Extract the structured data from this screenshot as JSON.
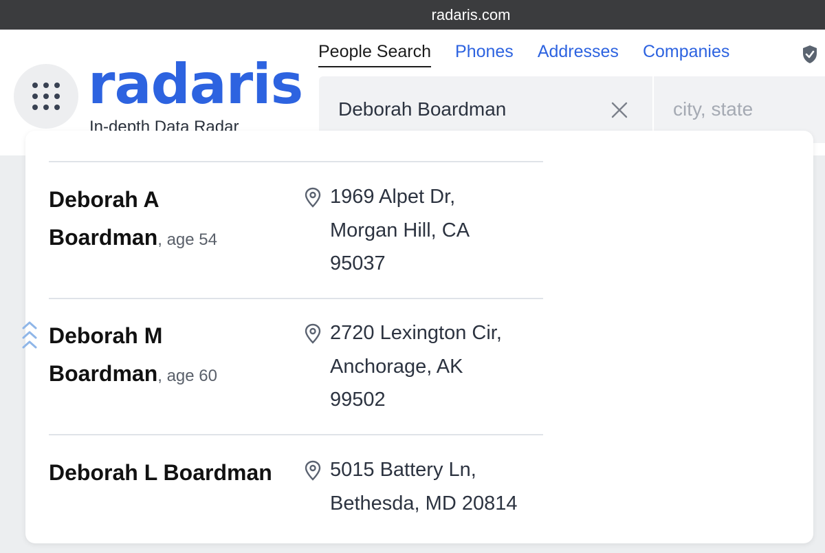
{
  "browser": {
    "url": "radaris.com"
  },
  "header": {
    "logo_text": "radaris",
    "tagline": "In-depth Data Radar",
    "nav": [
      {
        "label": "People Search",
        "active": true
      },
      {
        "label": "Phones",
        "active": false
      },
      {
        "label": "Addresses",
        "active": false
      },
      {
        "label": "Companies",
        "active": false
      }
    ],
    "search": {
      "name_value": "Deborah Boardman",
      "location_placeholder": "city, state"
    },
    "colors": {
      "brand": "#2d63e0",
      "text": "#2c3340"
    }
  },
  "results": [
    {
      "name_line1": "Deborah A",
      "name_line2": "Boardman",
      "age": ", age 54",
      "address": [
        "1969 Alpet Dr,",
        "Morgan Hill, CA",
        "95037"
      ]
    },
    {
      "name_line1": "Deborah M",
      "name_line2": "Boardman",
      "age": ", age 60",
      "address": [
        "2720 Lexington Cir,",
        "Anchorage, AK",
        "99502"
      ]
    },
    {
      "name_line1": "Deborah L Boardman",
      "name_line2": "",
      "age": "",
      "address": [
        "5015 Battery Ln,",
        "Bethesda, MD 20814"
      ]
    }
  ],
  "icons": {
    "menu": "grid-dots-icon",
    "shield": "shield-icon",
    "clear": "close-icon",
    "pin": "location-pin-icon",
    "scroll": "chevrons-up-icon"
  }
}
